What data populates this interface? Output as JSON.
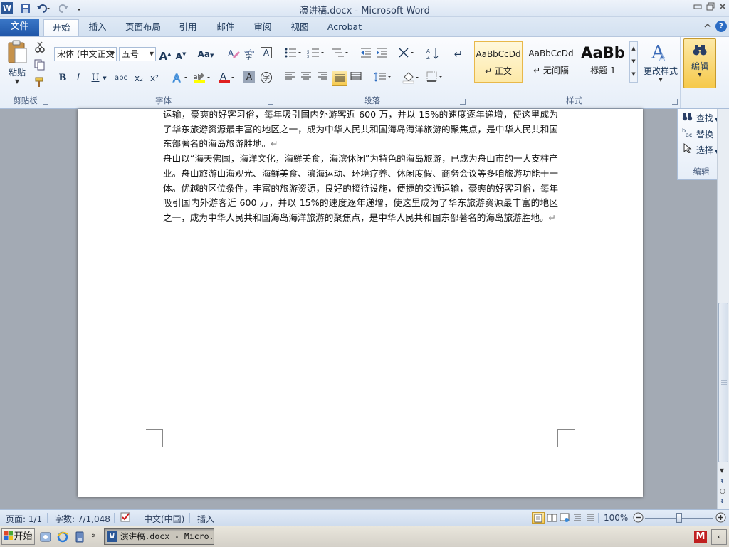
{
  "window": {
    "title": "演讲稿.docx - Microsoft Word"
  },
  "qat": {
    "word_icon": "W",
    "save_icon": "floppy-disk",
    "undo_icon": "undo-arrow",
    "redo_icon": "redo-arrow",
    "customize_icon": "dropdown-arrow"
  },
  "tabs": [
    "文件",
    "开始",
    "插入",
    "页面布局",
    "引用",
    "邮件",
    "审阅",
    "视图",
    "Acrobat"
  ],
  "clipboard": {
    "paste_label": "粘贴",
    "group_label": "剪贴板"
  },
  "font": {
    "font_name": "宋体 (中文正文",
    "font_size": "五号",
    "group_label": "字体",
    "bold": "B",
    "italic": "I",
    "underline": "U",
    "strike": "abc",
    "sub": "x₂",
    "sup": "x²",
    "grow": "A",
    "shrink": "A",
    "case": "Aa"
  },
  "paragraph": {
    "group_label": "段落"
  },
  "styles": {
    "group_label": "样式",
    "change_styles": "更改样式",
    "items": [
      {
        "sample": "AaBbCcDd",
        "name": "正文"
      },
      {
        "sample": "AaBbCcDd",
        "name": "无间隔"
      },
      {
        "sample": "AaBb",
        "name": "标题 1"
      }
    ]
  },
  "editing": {
    "button_label": "编辑",
    "group_label": "编辑",
    "find": "查找",
    "replace": "替换",
    "select": "选择"
  },
  "document": {
    "paragraphs": [
      "运输，豪爽的好客习俗，每年吸引国内外游客近 600 万，并以 15%的速度逐年递增，使这里成为了华东旅游资源最丰富的地区之一，成为中华人民共和国海岛海洋旅游的聚焦点，是中华人民共和国东部著名的海岛旅游胜地。",
      "舟山以“海天佛国，海洋文化，海鲜美食，海滨休闲”为特色的海岛旅游，已成为舟山市的一大支柱产业。舟山旅游山海观光、海鲜美食、滨海运动、环境疗养、休闲度假、商务会议等多咱旅游功能于一体。优越的区位条件，丰富的旅游资源，良好的接待设施，便捷的交通运输，豪爽的好客习俗，每年吸引国内外游客近 600 万，并以 15%的速度逐年递增，使这里成为了华东旅游资源最丰富的地区之一，成为中华人民共和国海岛海洋旅游的聚焦点，是中华人民共和国东部著名的海岛旅游胜地。"
    ],
    "para_mark": "↵"
  },
  "status": {
    "page": "页面: 1/1",
    "words": "字数: 7/1,048",
    "language": "中文(中国)",
    "mode": "插入",
    "zoom": "100%"
  },
  "taskbar": {
    "start": "开始",
    "word_task": "演讲稿.docx - Micro..."
  },
  "colors": {
    "accent": "#2b579a",
    "font_color": "#e02020",
    "highlight": "#ffff00"
  }
}
